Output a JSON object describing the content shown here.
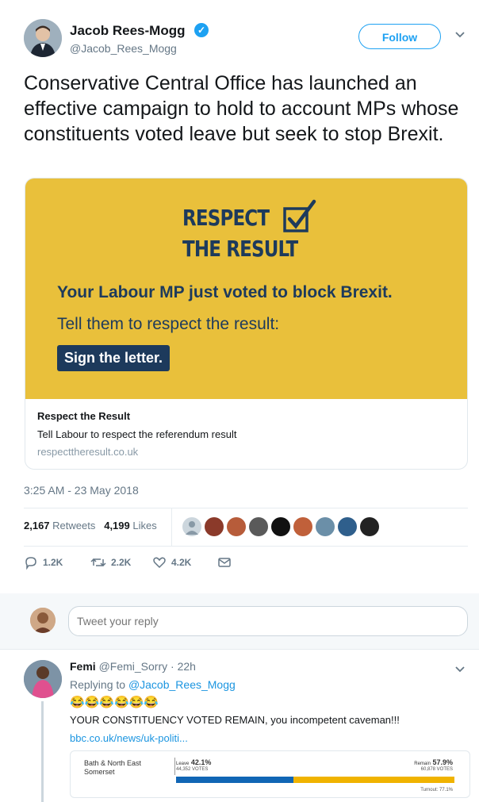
{
  "tweet": {
    "author_name": "Jacob Rees-Mogg",
    "author_handle": "@Jacob_Rees_Mogg",
    "follow_label": "Follow",
    "text": "Conservative Central Office has launched an effective campaign to hold to account MPs whose constituents voted leave but seek to stop Brexit.",
    "card": {
      "image_headline_1": "RESPECT",
      "image_headline_2": "THE RESULT",
      "image_message": "Your Labour MP just voted to block Brexit.",
      "image_sub": "Tell them to respect the result:",
      "image_button": "Sign the letter.",
      "title": "Respect the Result",
      "description": "Tell Labour to respect the referendum result",
      "url": "respecttheresult.co.uk",
      "colors": {
        "background": "#e9c03b",
        "navy": "#1d3a5c"
      }
    },
    "timestamp": "3:25 AM - 23 May 2018",
    "retweets_count": "2,167",
    "retweets_label": "Retweets",
    "likes_count": "4,199",
    "likes_label": "Likes",
    "actions": {
      "reply_count": "1.2K",
      "retweet_count": "2.2K",
      "like_count": "4.2K"
    }
  },
  "reply_box": {
    "placeholder": "Tweet your reply"
  },
  "reply": {
    "author_name": "Femi",
    "author_handle": "@Femi_Sorry",
    "time": "· 22h",
    "replying_prefix": "Replying to",
    "replying_handle": "@Jacob_Rees_Mogg",
    "emojis": "😂😂😂😂😂😂",
    "text": "YOUR CONSTITUENCY VOTED REMAIN, you incompetent caveman!!!",
    "link": "bbc.co.uk/news/uk-politi...",
    "result": {
      "place": "Bath & North East Somerset",
      "leave_label": "Leave",
      "leave_pct": "42.1%",
      "leave_votes": "44,352 VOTES",
      "remain_label": "Remain",
      "remain_pct": "57.9%",
      "remain_votes": "60,878 VOTES",
      "turnout": "Turnout: 77.1%",
      "leave_share": 0.421,
      "colors": {
        "leave": "#1166b5",
        "remain": "#f0b300"
      }
    }
  },
  "colors": {
    "accent": "#1da1f2",
    "link": "#1b95e0",
    "muted": "#657786"
  }
}
